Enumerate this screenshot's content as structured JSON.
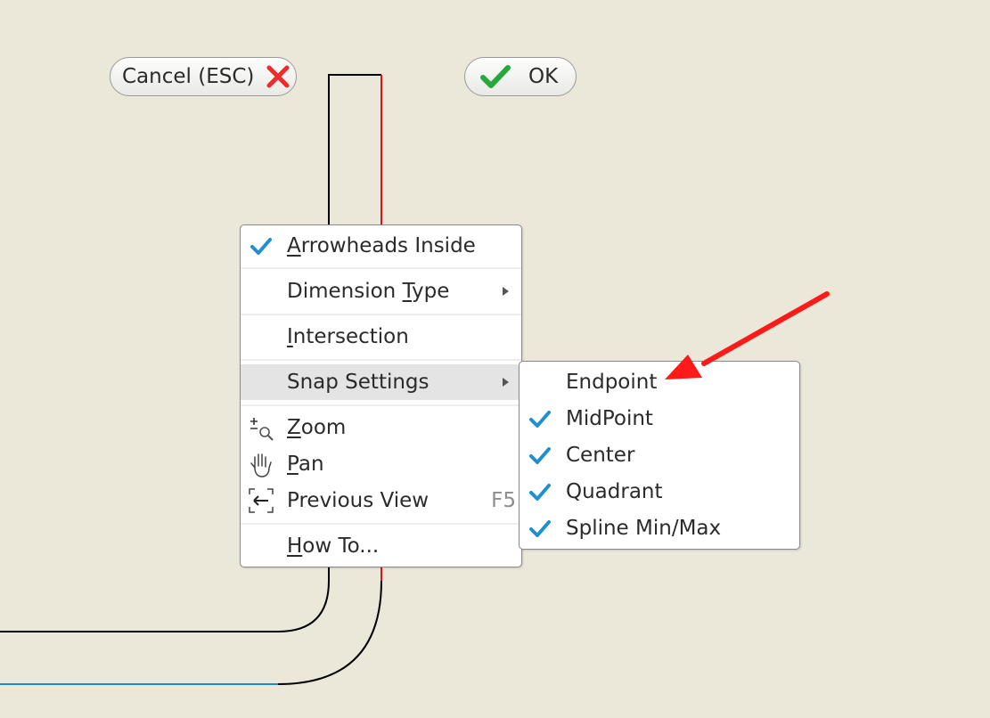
{
  "toolbar": {
    "cancel_label": "Cancel (ESC)",
    "ok_label": "OK",
    "cancel_icon": "red-x-icon",
    "ok_icon": "green-check-icon"
  },
  "context_menu": {
    "items": [
      {
        "label_pre": "",
        "label_ul": "A",
        "label_post": "rrowheads Inside",
        "checked": true
      },
      {
        "label_pre": "Dimension ",
        "label_ul": "T",
        "label_post": "ype",
        "has_submenu": true
      },
      {
        "label_pre": "",
        "label_ul": "I",
        "label_post": "ntersection"
      },
      {
        "label_pre": "Snap Settings",
        "label_ul": "",
        "label_post": "",
        "has_submenu": true,
        "highlighted": true
      },
      {
        "label_pre": "",
        "label_ul": "Z",
        "label_post": "oom",
        "icon": "zoom-icon"
      },
      {
        "label_pre": "",
        "label_ul": "P",
        "label_post": "an",
        "icon": "hand-pan-icon"
      },
      {
        "label_pre": "Previous View",
        "label_ul": "",
        "label_post": "",
        "icon": "previous-view-icon",
        "shortcut": "F5"
      },
      {
        "label_pre": "",
        "label_ul": "H",
        "label_post": "ow To..."
      }
    ]
  },
  "snap_submenu": {
    "items": [
      {
        "label": "Endpoint",
        "checked": false
      },
      {
        "label": "MidPoint",
        "checked": true
      },
      {
        "label": "Center",
        "checked": true
      },
      {
        "label": "Quadrant",
        "checked": true
      },
      {
        "label": "Spline Min/Max",
        "checked": true
      }
    ]
  },
  "colors": {
    "background": "#ebe8d9",
    "check_blue": "#1e8fd0",
    "annotation_red": "#ff1a1a"
  }
}
